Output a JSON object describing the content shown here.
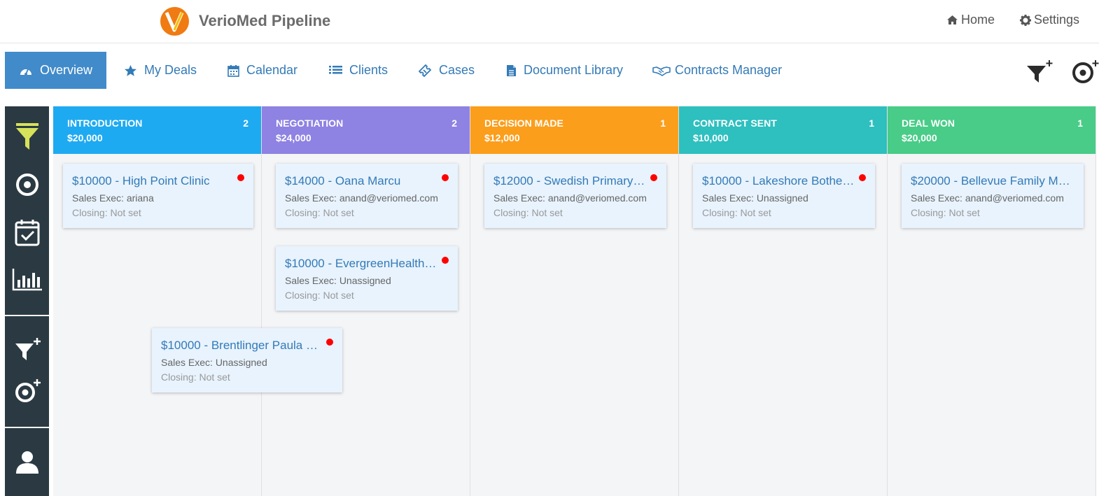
{
  "app": {
    "title": "VerioMed Pipeline",
    "logo_letter": "V"
  },
  "top_links": {
    "home": "Home",
    "settings": "Settings"
  },
  "nav": [
    {
      "label": "Overview",
      "icon": "dashboard-icon",
      "active": true
    },
    {
      "label": "My Deals",
      "icon": "star-icon"
    },
    {
      "label": "Calendar",
      "icon": "calendar-icon"
    },
    {
      "label": "Clients",
      "icon": "list-icon"
    },
    {
      "label": "Cases",
      "icon": "ticket-icon"
    },
    {
      "label": "Document Library",
      "icon": "document-icon"
    },
    {
      "label": "Contracts Manager",
      "icon": "handshake-icon"
    }
  ],
  "columns": [
    {
      "name": "INTRODUCTION",
      "count": "2",
      "total": "$20,000",
      "color": "#1eaaf1"
    },
    {
      "name": "NEGOTIATION",
      "count": "2",
      "total": "$24,000",
      "color": "#8e82e3"
    },
    {
      "name": "DECISION MADE",
      "count": "1",
      "total": "$12,000",
      "color": "#fb9e1b"
    },
    {
      "name": "CONTRACT SENT",
      "count": "1",
      "total": "$10,000",
      "color": "#2ebfbf"
    },
    {
      "name": "DEAL WON",
      "count": "1",
      "total": "$20,000",
      "color": "#48cc87"
    }
  ],
  "cards": [
    {
      "title": "$10000 - High Point Clinic",
      "exec": "Sales Exec: ariana",
      "closing": "Closing: Not set"
    },
    {
      "title": "$14000 - Oana Marcu",
      "exec": "Sales Exec: anand@veriomed.com",
      "closing": "Closing: Not set"
    },
    {
      "title": "$10000 - EvergreenHealth…",
      "exec": "Sales Exec: Unassigned",
      "closing": "Closing: Not set"
    },
    {
      "title": "$12000 - Swedish Primary…",
      "exec": "Sales Exec: anand@veriomed.com",
      "closing": "Closing: Not set"
    },
    {
      "title": "$10000 - Lakeshore Bothe…",
      "exec": "Sales Exec: Unassigned",
      "closing": "Closing: Not set"
    },
    {
      "title": "$20000 - Bellevue Family M…",
      "exec": "Sales Exec: anand@veriomed.com",
      "closing": "Closing: Not set"
    },
    {
      "title": "$10000 - Brentlinger Paula …",
      "exec": "Sales Exec: Unassigned",
      "closing": "Closing: Not set"
    }
  ],
  "colors": {
    "nav_active": "#428bca",
    "link": "#337ab7",
    "rail": "#2b3a42",
    "funnel_accent": "#d6e25a",
    "status_dot": "#ff0000"
  }
}
